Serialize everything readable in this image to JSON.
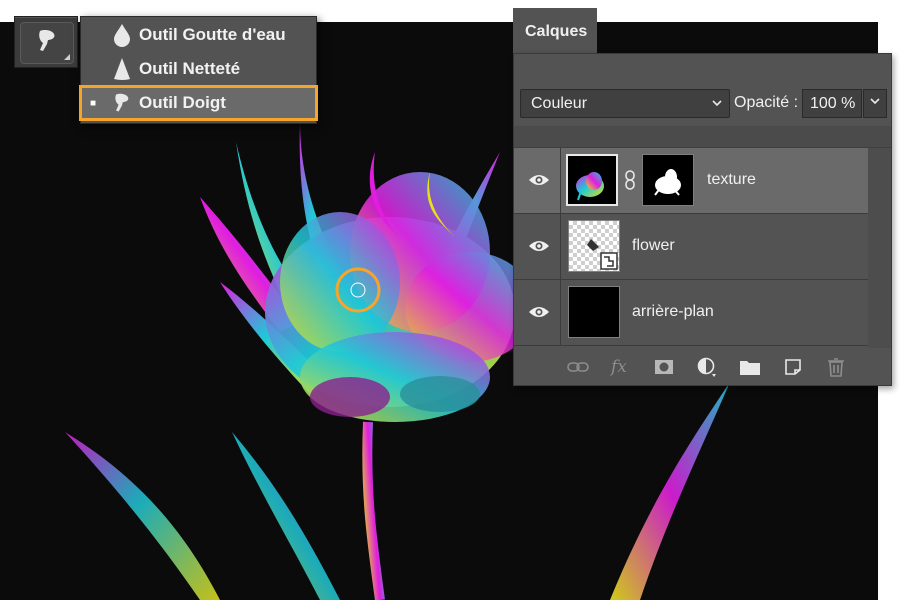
{
  "toolbar": {
    "active_tool_icon": "smudge-finger-icon"
  },
  "flyout": {
    "items": [
      {
        "label": "Outil Goutte d'eau",
        "icon": "blur-drop-icon",
        "selected": false
      },
      {
        "label": "Outil Netteté",
        "icon": "sharpen-cone-icon",
        "selected": false
      },
      {
        "label": "Outil Doigt",
        "icon": "smudge-finger-icon",
        "selected": true
      }
    ],
    "highlight_color": "#f5a52a"
  },
  "layers_panel": {
    "tab_label": "Calques",
    "blend_mode": "Couleur",
    "opacity_label": "Opacité :",
    "opacity_value": "100 %",
    "layers": [
      {
        "name": "texture",
        "visible": true,
        "active": true,
        "linked_mask": true
      },
      {
        "name": "flower",
        "visible": true,
        "active": false,
        "smart_object": true
      },
      {
        "name": "arrière-plan",
        "visible": true,
        "active": false
      }
    ],
    "footer_icons": [
      "link-layers-icon",
      "fx-icon",
      "add-mask-icon",
      "adjustment-layer-icon",
      "new-group-icon",
      "new-layer-icon",
      "trash-icon"
    ]
  },
  "canvas": {
    "background": "#0b0b0b",
    "cursor_ring_color": "#f5a52a",
    "artwork_colors": [
      "#e01ee0",
      "#1ec8d8",
      "#e6e01a"
    ]
  }
}
